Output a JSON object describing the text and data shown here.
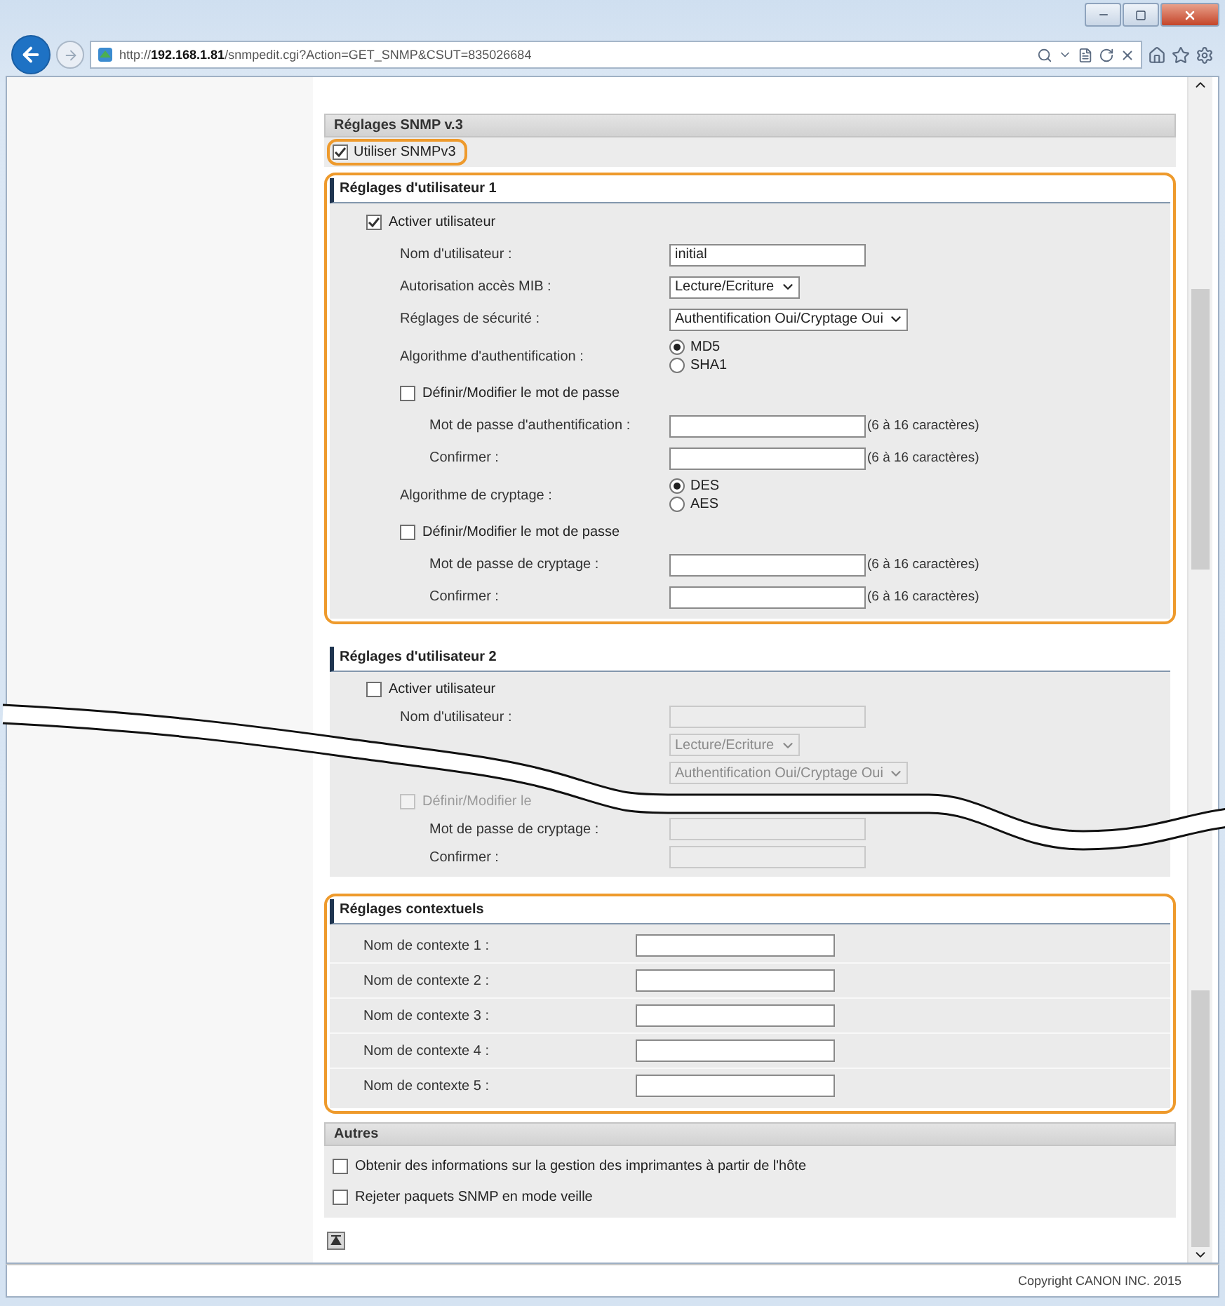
{
  "browser": {
    "url": "http://**192.168.1.81**/snmpedit.cgi?Action=GET_SNMP&CSUT=835026684"
  },
  "snmp_v3": {
    "title": "Réglages SNMP v.3",
    "use_snmpv3": {
      "label": "Utiliser SNMPv3",
      "checked": true,
      "highlighted": true
    }
  },
  "users": [
    {
      "title": "Réglages d'utilisateur 1",
      "highlighted": true,
      "disabled": false,
      "rows": [
        {
          "kind": "check",
          "label": "Activer utilisateur",
          "checked": true,
          "children": [
            {
              "kind": "text",
              "label": "Nom d'utilisateur :",
              "value": "initial"
            },
            {
              "kind": "select",
              "label": "Autorisation accès MIB :",
              "value": "Lecture/Ecriture"
            },
            {
              "kind": "select",
              "label": "Réglages de sécurité :",
              "value": "Authentification Oui/Cryptage Oui"
            },
            {
              "kind": "radio",
              "label": "Algorithme d'authentification :",
              "options": [
                {
                  "label": "MD5",
                  "selected": true
                },
                {
                  "label": "SHA1",
                  "selected": false
                }
              ]
            },
            {
              "kind": "check",
              "label": "Définir/Modifier le mot de passe",
              "checked": false,
              "children": [
                {
                  "kind": "text",
                  "label": "Mot de passe d'authentification :",
                  "hint": "(6 à 16 caractères)"
                },
                {
                  "kind": "text",
                  "label": "Confirmer :",
                  "hint": "(6 à 16 caractères)"
                }
              ]
            },
            {
              "kind": "radio",
              "label": "Algorithme de cryptage :",
              "options": [
                {
                  "label": "DES",
                  "selected": true
                },
                {
                  "label": "AES",
                  "selected": false
                }
              ]
            },
            {
              "kind": "check",
              "label": "Définir/Modifier le mot de passe",
              "checked": false,
              "children": [
                {
                  "kind": "text",
                  "label": "Mot de passe de cryptage :",
                  "hint": "(6 à 16 caractères)"
                },
                {
                  "kind": "text",
                  "label": "Confirmer :",
                  "hint": "(6 à 16 caractères)"
                }
              ]
            }
          ]
        }
      ]
    },
    {
      "title": "Réglages d'utilisateur 2",
      "highlighted": false,
      "disabled": true,
      "broken": true,
      "rows": [
        {
          "kind": "check",
          "label": "Activer utilisateur",
          "checked": false,
          "children": [
            {
              "kind": "text",
              "label": "Nom d'utilisateur :"
            },
            {
              "kind": "select",
              "value": "Lecture/Ecriture"
            },
            {
              "kind": "select",
              "value": "Authentification Oui/Cryptage Oui"
            },
            {
              "kind": "check",
              "label": "Définir/Modifier le",
              "checked": false,
              "children": [
                {
                  "kind": "text",
                  "label": "Mot de passe de cryptage :"
                },
                {
                  "kind": "text",
                  "label": "Confirmer :"
                }
              ]
            }
          ]
        }
      ]
    }
  ],
  "contexts": {
    "title": "Réglages contextuels",
    "highlighted": true,
    "fields": [
      {
        "label": "Nom de contexte 1 :"
      },
      {
        "label": "Nom de contexte 2 :"
      },
      {
        "label": "Nom de contexte 3 :"
      },
      {
        "label": "Nom de contexte 4 :"
      },
      {
        "label": "Nom de contexte 5 :"
      }
    ]
  },
  "others": {
    "title": "Autres",
    "options": [
      {
        "label": "Obtenir des informations sur la gestion des imprimantes à partir de l'hôte",
        "checked": false
      },
      {
        "label": "Rejeter paquets SNMP en mode veille",
        "checked": false
      }
    ]
  },
  "footer": {
    "copyright": "Copyright CANON INC. 2015"
  }
}
